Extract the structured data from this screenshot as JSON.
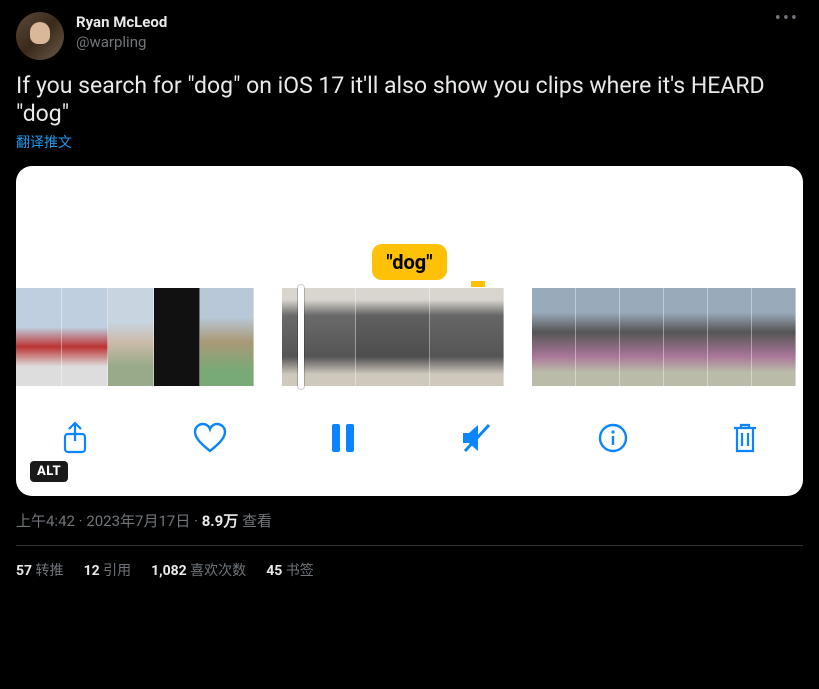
{
  "author": {
    "displayName": "Ryan McLeod",
    "handle": "@warpling"
  },
  "tweet": {
    "text": "If you search for \"dog\" on iOS 17 it'll also show you clips where it's HEARD \"dog\"",
    "translateLabel": "翻译推文"
  },
  "media": {
    "bubbleText": "\"dog\"",
    "altBadge": "ALT",
    "controls": {
      "share": "share",
      "like": "like",
      "pause": "pause",
      "mute": "mute",
      "info": "info",
      "trash": "trash"
    }
  },
  "meta": {
    "time": "上午4:42",
    "date": "2023年7月17日",
    "separator": " · ",
    "viewsNumber": "8.9万",
    "viewsLabel": " 查看"
  },
  "stats": {
    "retweets": {
      "num": "57",
      "label": " 转推"
    },
    "quotes": {
      "num": "12",
      "label": " 引用"
    },
    "likes": {
      "num": "1,082",
      "label": " 喜欢次数"
    },
    "bookmarks": {
      "num": "45",
      "label": " 书签"
    }
  }
}
